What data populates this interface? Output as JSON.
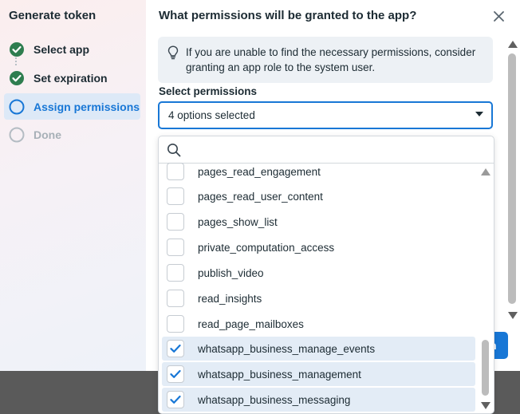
{
  "wizard": {
    "title": "Generate token",
    "steps": [
      {
        "label": "Select app",
        "state": "done"
      },
      {
        "label": "Set expiration",
        "state": "done"
      },
      {
        "label": "Assign permissions",
        "state": "active"
      },
      {
        "label": "Done",
        "state": "todo"
      }
    ]
  },
  "panel": {
    "title": "What permissions will be granted to the app?",
    "info_text": "If you are unable to find the necessary permissions, consider granting an app role to the system user.",
    "select_label": "Select permissions",
    "select_value": "4 options selected",
    "partial_button_text": "n"
  },
  "dropdown": {
    "search_placeholder": "",
    "options": [
      {
        "label": "pages_read_engagement",
        "checked": false
      },
      {
        "label": "pages_read_user_content",
        "checked": false
      },
      {
        "label": "pages_show_list",
        "checked": false
      },
      {
        "label": "private_computation_access",
        "checked": false
      },
      {
        "label": "publish_video",
        "checked": false
      },
      {
        "label": "read_insights",
        "checked": false
      },
      {
        "label": "read_page_mailboxes",
        "checked": false
      },
      {
        "label": "whatsapp_business_manage_events",
        "checked": true
      },
      {
        "label": "whatsapp_business_management",
        "checked": true
      },
      {
        "label": "whatsapp_business_messaging",
        "checked": true
      }
    ]
  },
  "colors": {
    "accent": "#1877d6",
    "check_green": "#2e7d4f",
    "text": "#1c2b33",
    "muted": "#a7b0b7"
  }
}
